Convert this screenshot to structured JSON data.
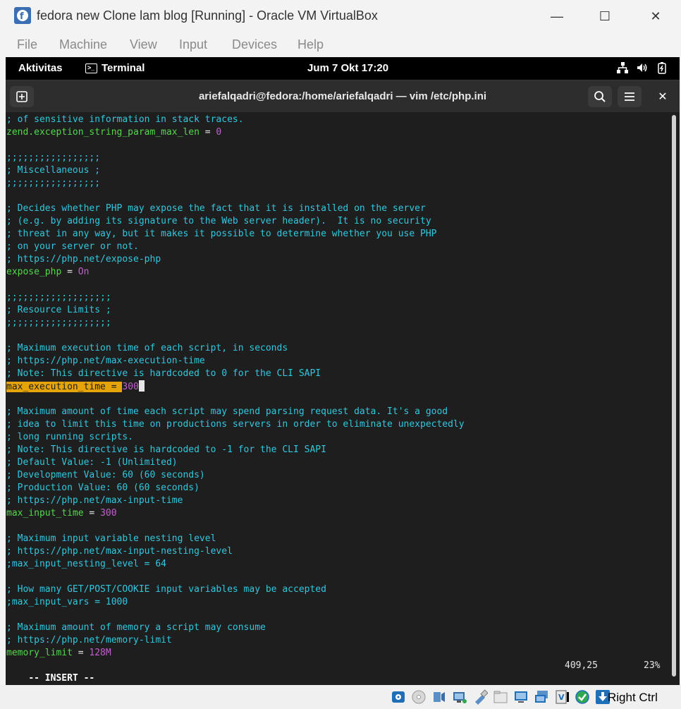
{
  "window": {
    "title": "fedora new Clone lam blog [Running] - Oracle VM VirtualBox",
    "minimize_glyph": "—",
    "maximize_glyph": "☐",
    "close_glyph": "✕"
  },
  "vbox_menu": [
    "File",
    "Machine",
    "View",
    "Input",
    "Devices",
    "Help"
  ],
  "gnome": {
    "activities": "Aktivitas",
    "app_name": "Terminal",
    "clock": "Jum 7 Okt  17:20"
  },
  "terminal": {
    "title": "ariefalqadri@fedora:/home/ariefalqadri — vim /etc/php.ini",
    "close_glyph": "✕"
  },
  "editor": {
    "lines": [
      [
        {
          "t": "; of sensitive information in stack traces.",
          "k": "comment"
        }
      ],
      [
        {
          "t": "zend.exception_string_param_max_len",
          "k": "key"
        },
        {
          "t": " = ",
          "k": "op"
        },
        {
          "t": "0",
          "k": "val"
        }
      ],
      [],
      [
        {
          "t": ";;;;;;;;;;;;;;;;;",
          "k": "comment"
        }
      ],
      [
        {
          "t": "; Miscellaneous ;",
          "k": "comment"
        }
      ],
      [
        {
          "t": ";;;;;;;;;;;;;;;;;",
          "k": "comment"
        }
      ],
      [],
      [
        {
          "t": "; Decides whether PHP may expose the fact that it is installed on the server",
          "k": "comment"
        }
      ],
      [
        {
          "t": "; (e.g. by adding its signature to the Web server header).  It is no security",
          "k": "comment"
        }
      ],
      [
        {
          "t": "; threat in any way, but it makes it possible to determine whether you use PHP",
          "k": "comment"
        }
      ],
      [
        {
          "t": "; on your server or not.",
          "k": "comment"
        }
      ],
      [
        {
          "t": "; https://php.net/expose-php",
          "k": "comment"
        }
      ],
      [
        {
          "t": "expose_php",
          "k": "key"
        },
        {
          "t": " = ",
          "k": "op"
        },
        {
          "t": "On",
          "k": "val"
        }
      ],
      [],
      [
        {
          "t": ";;;;;;;;;;;;;;;;;;;",
          "k": "comment"
        }
      ],
      [
        {
          "t": "; Resource Limits ;",
          "k": "comment"
        }
      ],
      [
        {
          "t": ";;;;;;;;;;;;;;;;;;;",
          "k": "comment"
        }
      ],
      [],
      [
        {
          "t": "; Maximum execution time of each script, in seconds",
          "k": "comment"
        }
      ],
      [
        {
          "t": "; https://php.net/max-execution-time",
          "k": "comment"
        }
      ],
      [
        {
          "t": "; Note: This directive is hardcoded to 0 for the CLI SAPI",
          "k": "comment"
        }
      ],
      [
        {
          "t": "max_execution_time = ",
          "k": "hl"
        },
        {
          "t": "300",
          "k": "val"
        },
        {
          "t": "",
          "k": "cursor"
        }
      ],
      [],
      [
        {
          "t": "; Maximum amount of time each script may spend parsing request data. It's a good",
          "k": "comment"
        }
      ],
      [
        {
          "t": "; idea to limit this time on productions servers in order to eliminate unexpectedly",
          "k": "comment"
        }
      ],
      [
        {
          "t": "; long running scripts.",
          "k": "comment"
        }
      ],
      [
        {
          "t": "; Note: This directive is hardcoded to -1 for the CLI SAPI",
          "k": "comment"
        }
      ],
      [
        {
          "t": "; Default Value: -1 (Unlimited)",
          "k": "comment"
        }
      ],
      [
        {
          "t": "; Development Value: 60 (60 seconds)",
          "k": "comment"
        }
      ],
      [
        {
          "t": "; Production Value: 60 (60 seconds)",
          "k": "comment"
        }
      ],
      [
        {
          "t": "; https://php.net/max-input-time",
          "k": "comment"
        }
      ],
      [
        {
          "t": "max_input_time",
          "k": "key"
        },
        {
          "t": " = ",
          "k": "op"
        },
        {
          "t": "300",
          "k": "val"
        }
      ],
      [],
      [
        {
          "t": "; Maximum input variable nesting level",
          "k": "comment"
        }
      ],
      [
        {
          "t": "; https://php.net/max-input-nesting-level",
          "k": "comment"
        }
      ],
      [
        {
          "t": ";max_input_nesting_level = 64",
          "k": "comment"
        }
      ],
      [],
      [
        {
          "t": "; How many GET/POST/COOKIE input variables may be accepted",
          "k": "comment"
        }
      ],
      [
        {
          "t": ";max_input_vars = 1000",
          "k": "comment"
        }
      ],
      [],
      [
        {
          "t": "; Maximum amount of memory a script may consume",
          "k": "comment"
        }
      ],
      [
        {
          "t": "; https://php.net/memory-limit",
          "k": "comment"
        }
      ],
      [
        {
          "t": "memory_limit",
          "k": "key"
        },
        {
          "t": " = ",
          "k": "op"
        },
        {
          "t": "128M",
          "k": "val"
        }
      ]
    ],
    "mode": "-- INSERT --",
    "position": "409,25",
    "percent": "23%"
  },
  "vbox_status": {
    "host_key": "Right Ctrl"
  },
  "colors": {
    "comment": "#33c7de",
    "key": "#52d94b",
    "value": "#c061cb",
    "highlight": "#e5a50a",
    "terminal_bg": "#1e1e1e"
  }
}
